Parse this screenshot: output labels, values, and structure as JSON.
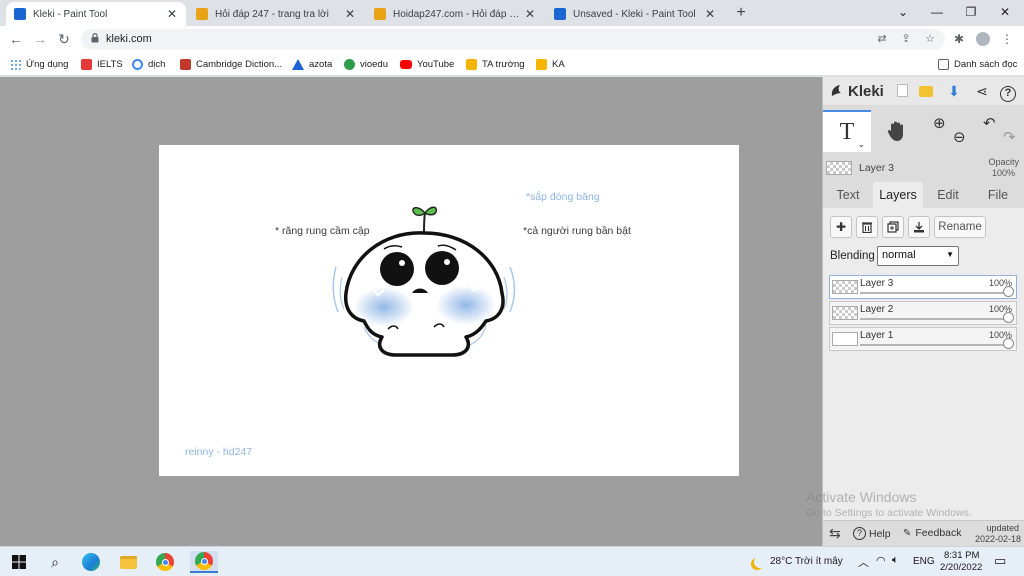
{
  "browser": {
    "tabs": [
      {
        "title": "Kleki - Paint Tool",
        "active": true
      },
      {
        "title": "Hỏi đáp 247 - trang tra lời",
        "active": false
      },
      {
        "title": "Hoidap247.com - Hỏi đáp bài tập",
        "active": false
      },
      {
        "title": "Unsaved - Kleki - Paint Tool",
        "active": false
      }
    ],
    "url": "kleki.com",
    "bookmarks": [
      {
        "label": "Ứng dụng",
        "icon": "apps-grid-icon",
        "color": "#4285f4"
      },
      {
        "label": "IELTS",
        "icon": "ielts-icon",
        "color": "#e53935"
      },
      {
        "label": "dịch",
        "icon": "google-icon",
        "color": "#4285f4"
      },
      {
        "label": "Cambridge Diction...",
        "icon": "cambridge-icon",
        "color": "#c0392b"
      },
      {
        "label": "azota",
        "icon": "azota-icon",
        "color": "#1e63d6"
      },
      {
        "label": "vioedu",
        "icon": "vioedu-icon",
        "color": "#2e9c4a"
      },
      {
        "label": "YouTube",
        "icon": "youtube-icon",
        "color": "#ff0000"
      },
      {
        "label": "TA trường",
        "icon": "classroom-icon",
        "color": "#f4b400"
      },
      {
        "label": "KA",
        "icon": "classroom-icon",
        "color": "#f4b400"
      }
    ],
    "reading_list": "Danh sách đọc"
  },
  "canvas_text": {
    "note1": "*sắp đóng băng",
    "note2": "* răng rung cầm cập",
    "note3": "*cả người rung bần bật",
    "signature": "reinny - hd247"
  },
  "panel": {
    "brand": "Kleki",
    "current_layer": "Layer 3",
    "opacity_label": "Opacity",
    "opacity_value": "100%",
    "tabs": [
      "Text",
      "Layers",
      "Edit",
      "File"
    ],
    "active_tab": "Layers",
    "rename_label": "Rename",
    "blending_label": "Blending",
    "blending_value": "normal",
    "layers": [
      {
        "name": "Layer 3",
        "opacity": "100%",
        "selected": true
      },
      {
        "name": "Layer 2",
        "opacity": "100%",
        "selected": false
      },
      {
        "name": "Layer 1",
        "opacity": "100%",
        "selected": false
      }
    ],
    "footer": {
      "help": "Help",
      "feedback": "Feedback",
      "updated_label": "updated",
      "updated_date": "2022-02-18"
    }
  },
  "windows_watermark": {
    "line1": "Activate Windows",
    "line2": "Go to Settings to activate Windows."
  },
  "taskbar": {
    "weather": "28°C  Trời ít mây",
    "language": "ENG",
    "time": "8:31 PM",
    "date": "2/20/2022"
  },
  "colors": {
    "accent": "#4a8ae0",
    "blush": "#8db4e6",
    "sprout": "#4caf50"
  }
}
